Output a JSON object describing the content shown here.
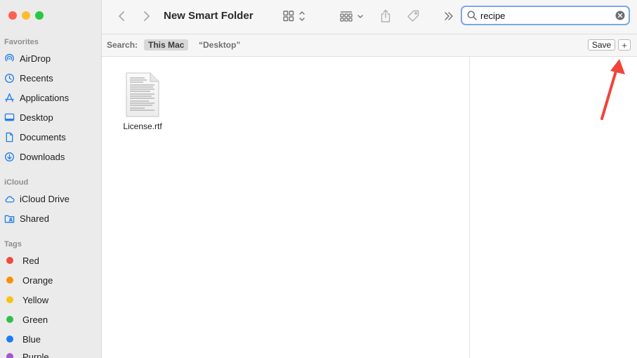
{
  "window": {
    "title": "New Smart Folder"
  },
  "sidebar": {
    "sections": [
      {
        "header": "Favorites",
        "items": [
          {
            "label": "AirDrop",
            "icon": "airdrop-icon"
          },
          {
            "label": "Recents",
            "icon": "clock-icon"
          },
          {
            "label": "Applications",
            "icon": "applications-icon"
          },
          {
            "label": "Desktop",
            "icon": "desktop-icon"
          },
          {
            "label": "Documents",
            "icon": "document-icon"
          },
          {
            "label": "Downloads",
            "icon": "download-icon"
          }
        ]
      },
      {
        "header": "iCloud",
        "items": [
          {
            "label": "iCloud Drive",
            "icon": "cloud-icon"
          },
          {
            "label": "Shared",
            "icon": "shared-folder-icon"
          }
        ]
      },
      {
        "header": "Tags",
        "items": [
          {
            "label": "Red",
            "color": "#f04a3e"
          },
          {
            "label": "Orange",
            "color": "#f5900a"
          },
          {
            "label": "Yellow",
            "color": "#f5c40e"
          },
          {
            "label": "Green",
            "color": "#2fbf4a"
          },
          {
            "label": "Blue",
            "color": "#1a7cf5"
          },
          {
            "label": "Purple",
            "color": "#a155d8"
          }
        ]
      }
    ]
  },
  "search": {
    "value": "recipe"
  },
  "scope": {
    "label": "Search:",
    "active": "This Mac",
    "other": "“Desktop”"
  },
  "actions": {
    "save": "Save",
    "add": "+"
  },
  "files": [
    {
      "name": "License.rtf",
      "icon": "rtf-document-icon"
    }
  ],
  "colors": {
    "accent": "#1a7cf5",
    "sidebar_icon": "#1f7ee8",
    "annotation_arrow": "#f0443a",
    "search_focus": "#7aa7e6"
  }
}
